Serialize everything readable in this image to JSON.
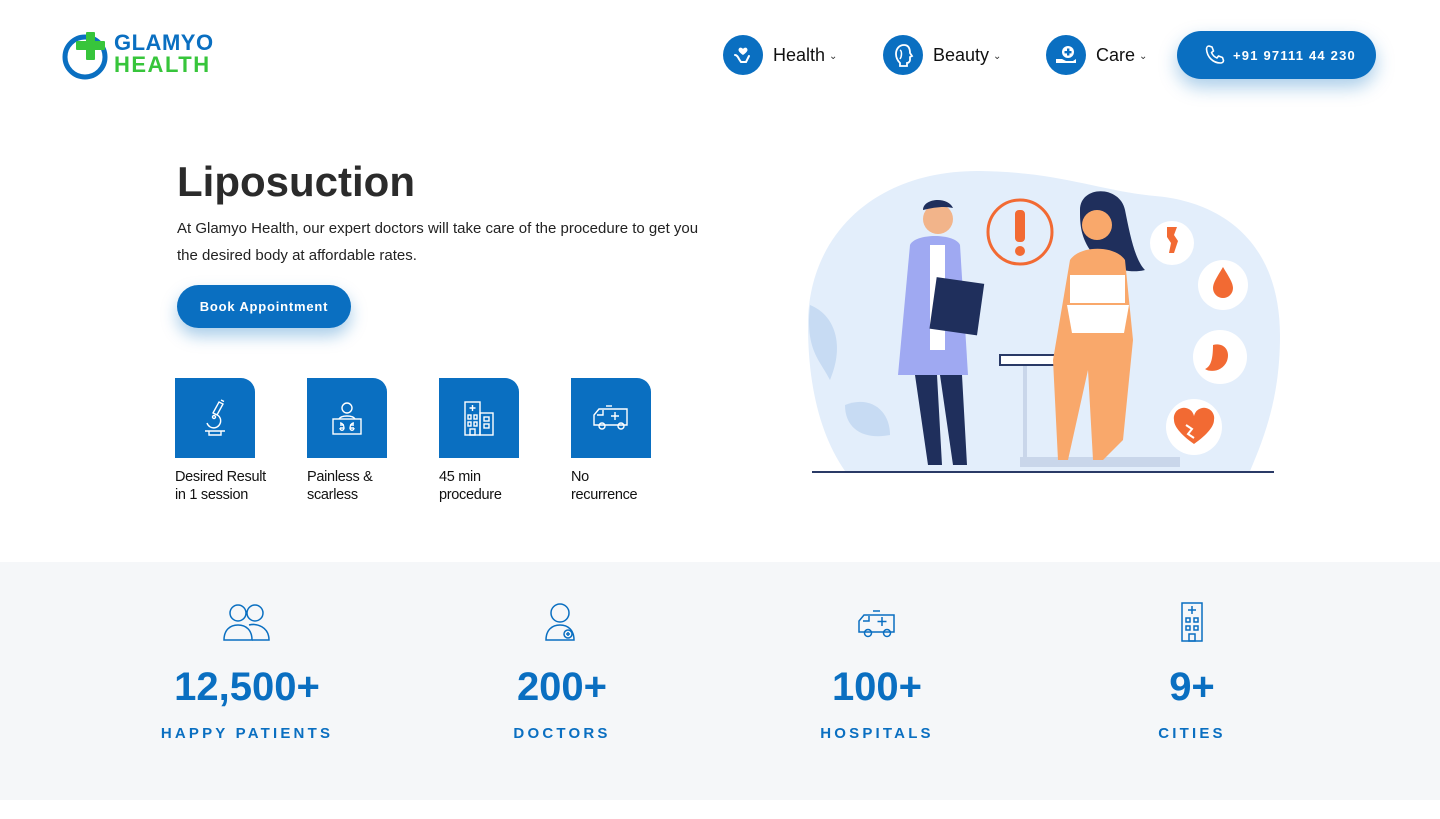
{
  "brand": {
    "line1": "GLAMYO",
    "line2": "HEALTH"
  },
  "colors": {
    "primary": "#0a6fc1",
    "accent_green": "#37c53b",
    "stats_bg": "#f5f7f9"
  },
  "nav": {
    "items": [
      {
        "label": "Health",
        "icon": "hand-heart-icon"
      },
      {
        "label": "Beauty",
        "icon": "face-profile-icon"
      },
      {
        "label": "Care",
        "icon": "hand-medical-icon"
      }
    ],
    "phone": "+91 97111 44 230"
  },
  "hero": {
    "title": "Liposuction",
    "description": "At Glamyo Health, our expert doctors will take care of the procedure to get you the desired body at affordable rates.",
    "cta": "Book Appointment"
  },
  "features": [
    {
      "icon": "microscope-icon",
      "label_line1": "Desired Result",
      "label_line2": "in 1 session"
    },
    {
      "icon": "doctor-xray-icon",
      "label_line1": "Painless &",
      "label_line2": "scarless"
    },
    {
      "icon": "hospital-building-icon",
      "label_line1": "45 min",
      "label_line2": "procedure"
    },
    {
      "icon": "ambulance-icon",
      "label_line1": "No",
      "label_line2": "recurrence"
    }
  ],
  "stats": [
    {
      "icon": "patients-icon",
      "value": "12,500+",
      "label": "HAPPY PATIENTS"
    },
    {
      "icon": "doctor-icon",
      "value": "200+",
      "label": "DOCTORS"
    },
    {
      "icon": "ambulance-icon",
      "value": "100+",
      "label": "HOSPITALS"
    },
    {
      "icon": "building-icon",
      "value": "9+",
      "label": "CITIES"
    }
  ]
}
